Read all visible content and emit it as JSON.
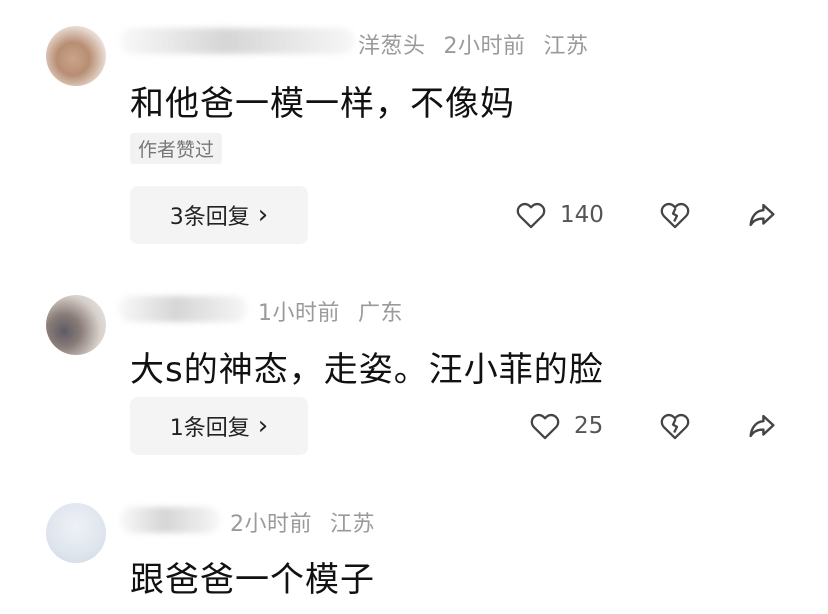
{
  "comments": [
    {
      "name_visible_part": "洋葱头",
      "time": "2小时前",
      "location": "江苏",
      "text": "和他爸一模一样，不像妈",
      "badge": "作者赞过",
      "replies": "3条回复",
      "reply_arrow": "›",
      "likes": "140"
    },
    {
      "name_visible_part": "",
      "time": "1小时前",
      "location": "广东",
      "text": "大s的神态，走姿。汪小菲的脸",
      "replies": "1条回复",
      "reply_arrow": "›",
      "likes": "25"
    },
    {
      "name_visible_part": "",
      "time": "2小时前",
      "location": "江苏",
      "text": "跟爸爸一个模子"
    }
  ],
  "icons": {
    "like": "heart-outline-icon",
    "dislike": "broken-heart-icon",
    "share": "share-arrow-icon"
  },
  "colors": {
    "text": "#111111",
    "meta": "#9a9a9a",
    "reply_bg": "#f4f4f4",
    "badge_bg": "#f2f2f2"
  }
}
